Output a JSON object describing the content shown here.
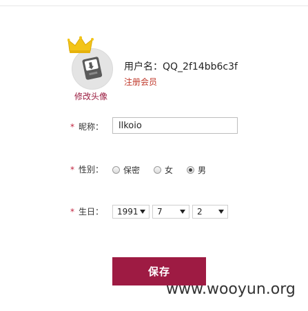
{
  "profile": {
    "avatar_edit_label": "修改头像",
    "username_label": "用户名：",
    "username_value": "QQ_2f14bb6c3f",
    "register_link": "注册会员"
  },
  "form": {
    "required_mark": "*",
    "nickname_label": "昵称：",
    "nickname_value": "llkoio",
    "gender_label": "性别：",
    "gender_options": [
      "保密",
      "女",
      "男"
    ],
    "gender_selected": "男",
    "birthday_label": "生日：",
    "birth_year": "1991",
    "birth_month": "7",
    "birth_day": "2",
    "save_label": "保存"
  },
  "colors": {
    "accent": "#9e1b43",
    "required": "#c0233e",
    "register_link": "#c0392b"
  },
  "watermark": "www.wooyun.org"
}
